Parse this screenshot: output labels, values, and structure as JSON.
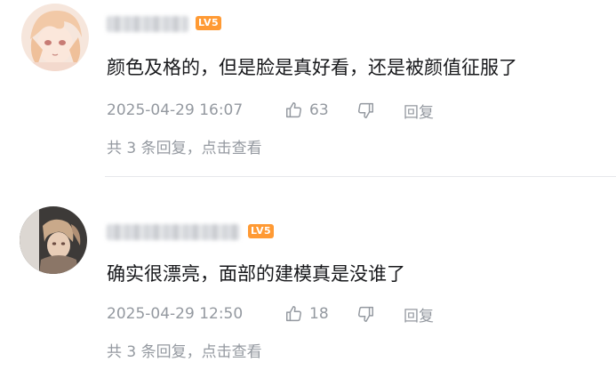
{
  "comments": [
    {
      "level_badge": "LV5",
      "text": "颜色及格的，但是脸是真好看，还是被颜值征服了",
      "timestamp": "2025-04-29 16:07",
      "likes": "63",
      "reply_label": "回复",
      "replies_summary": "共 3 条回复，点击查看",
      "avatar_icon": "anime-avatar-icon"
    },
    {
      "level_badge": "LV5",
      "text": "确实很漂亮，面部的建模真是没谁了",
      "timestamp": "2025-04-29 12:50",
      "likes": "18",
      "reply_label": "回复",
      "replies_summary": "共 3 条回复，点击查看",
      "avatar_icon": "anime-avatar-icon"
    }
  ],
  "icons": {
    "like": "thumbs-up-icon",
    "dislike": "thumbs-down-icon"
  },
  "colors": {
    "level_badge": "#ff9a34",
    "meta_text": "#9499a0",
    "main_text": "#18191c",
    "divider": "#e6e8eb"
  }
}
